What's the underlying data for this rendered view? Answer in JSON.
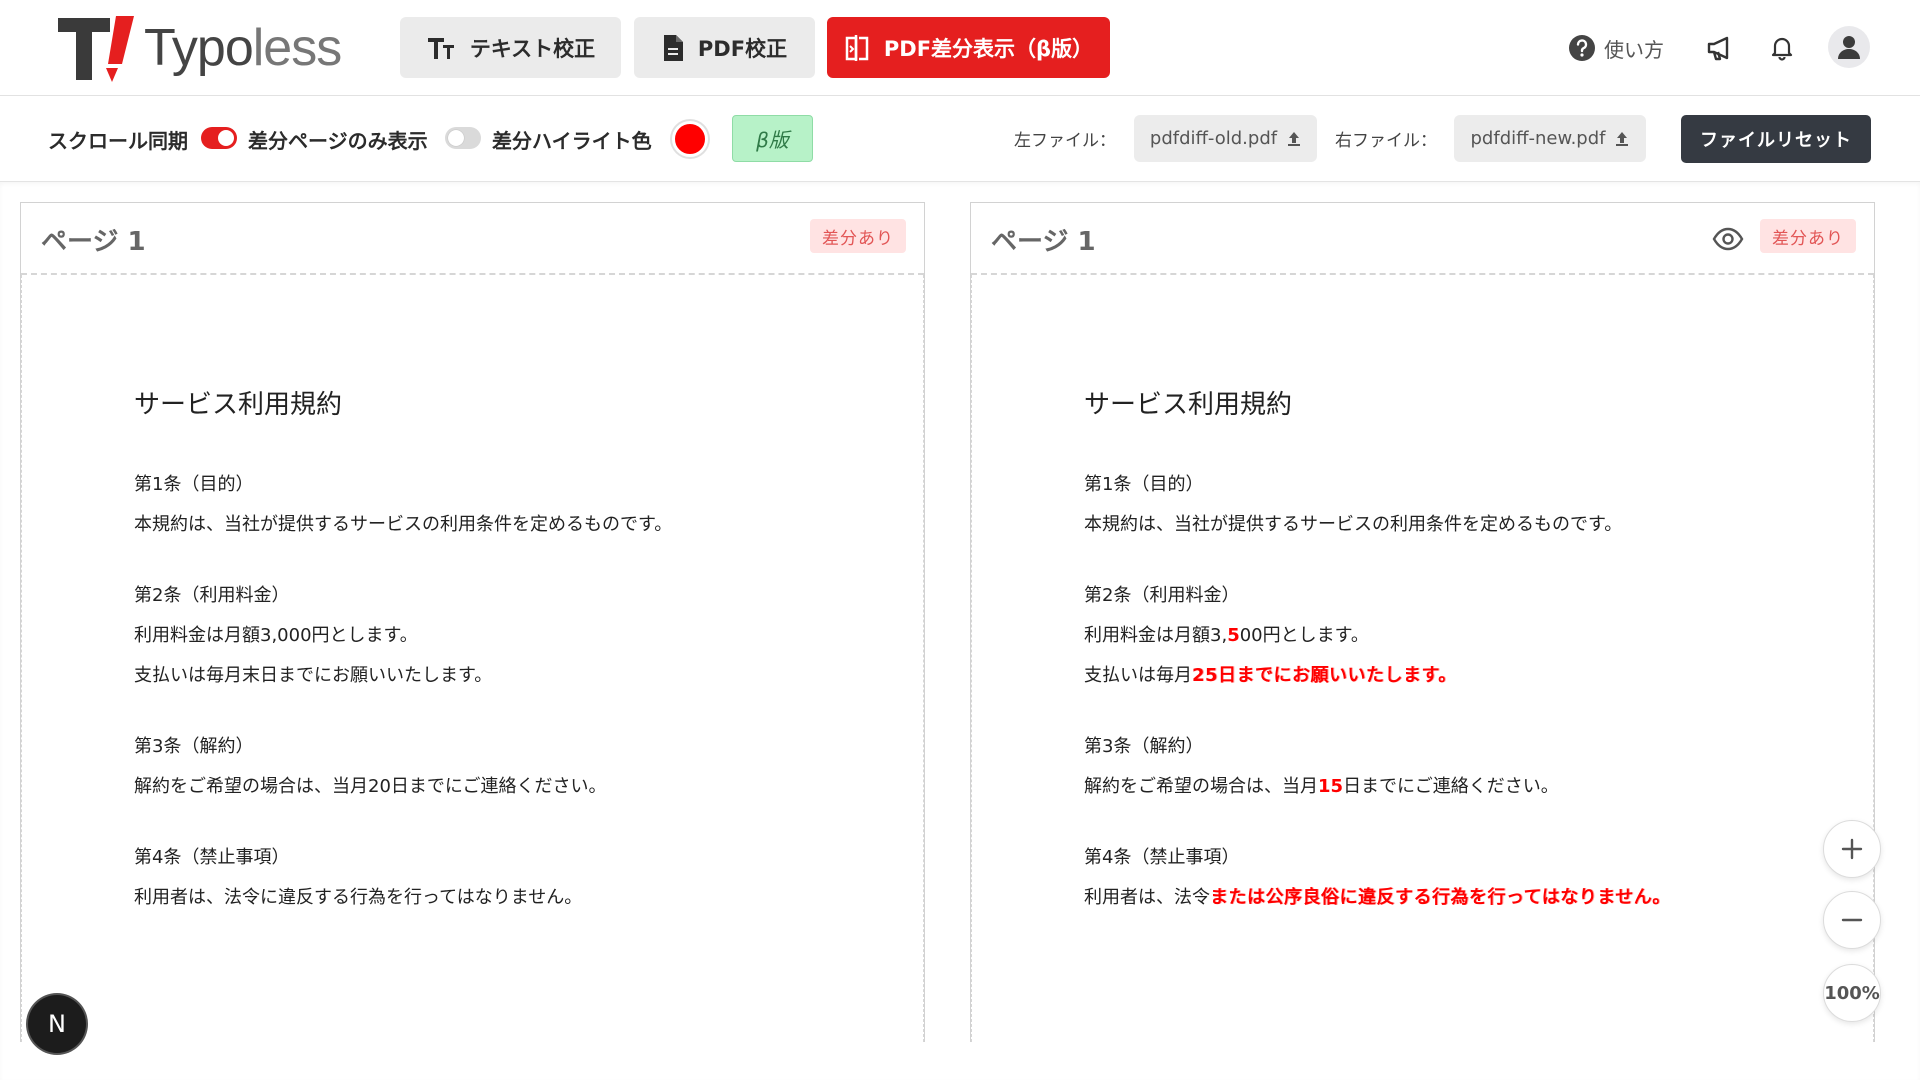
{
  "header": {
    "logo_text": "Typoless",
    "nav": {
      "text_check": "テキスト校正",
      "pdf_check": "PDF校正",
      "pdf_diff": "PDF差分表示（β版）"
    },
    "help_label": "使い方"
  },
  "toolbar": {
    "scroll_sync_label": "スクロール同期",
    "scroll_sync_on": true,
    "diff_only_label": "差分ページのみ表示",
    "diff_only_on": false,
    "highlight_color_label": "差分ハイライト色",
    "highlight_color": "#ff0000",
    "beta_label": "β版",
    "left_file_label": "左ファイル：",
    "left_file_name": "pdfdiff-old.pdf",
    "right_file_label": "右ファイル：",
    "right_file_name": "pdfdiff-new.pdf",
    "reset_label": "ファイルリセット"
  },
  "left_panel": {
    "page_title": "ページ 1",
    "diff_badge": "差分あり",
    "doc": {
      "title": "サービス利用規約",
      "a1_heading": "第1条（目的）",
      "a1_body": "本規約は、当社が提供するサービスの利用条件を定めるものです。",
      "a2_heading": "第2条（利用料金）",
      "a2_line1": "利用料金は月額3,000円とします。",
      "a2_line2": "支払いは毎月末日までにお願いいたします。",
      "a3_heading": "第3条（解約）",
      "a3_body": "解約をご希望の場合は、当月20日までにご連絡ください。",
      "a4_heading": "第4条（禁止事項）",
      "a4_body": "利用者は、法令に違反する行為を行ってはなりません。"
    }
  },
  "right_panel": {
    "page_title": "ページ 1",
    "diff_badge": "差分あり",
    "doc": {
      "title": "サービス利用規約",
      "a1_heading": "第1条（目的）",
      "a1_body": "本規約は、当社が提供するサービスの利用条件を定めるものです。",
      "a2_heading": "第2条（利用料金）",
      "a2_line1_pre": "利用料金は月額3,",
      "a2_line1_diff": "5",
      "a2_line1_post": "00円とします。",
      "a2_line2_pre": "支払いは毎月",
      "a2_line2_diff": "25日までにお願いいたします。",
      "a3_heading": "第3条（解約）",
      "a3_body_pre": "解約をご希望の場合は、当月",
      "a3_body_diff": "15",
      "a3_body_post": "日までにご連絡ください。",
      "a4_heading": "第4条（禁止事項）",
      "a4_body_pre": "利用者は、法令",
      "a4_body_diff": "または公序良俗に違反する行為を行ってはなりません。"
    }
  },
  "zoom": {
    "level": "100%"
  },
  "floating_badge": "N"
}
